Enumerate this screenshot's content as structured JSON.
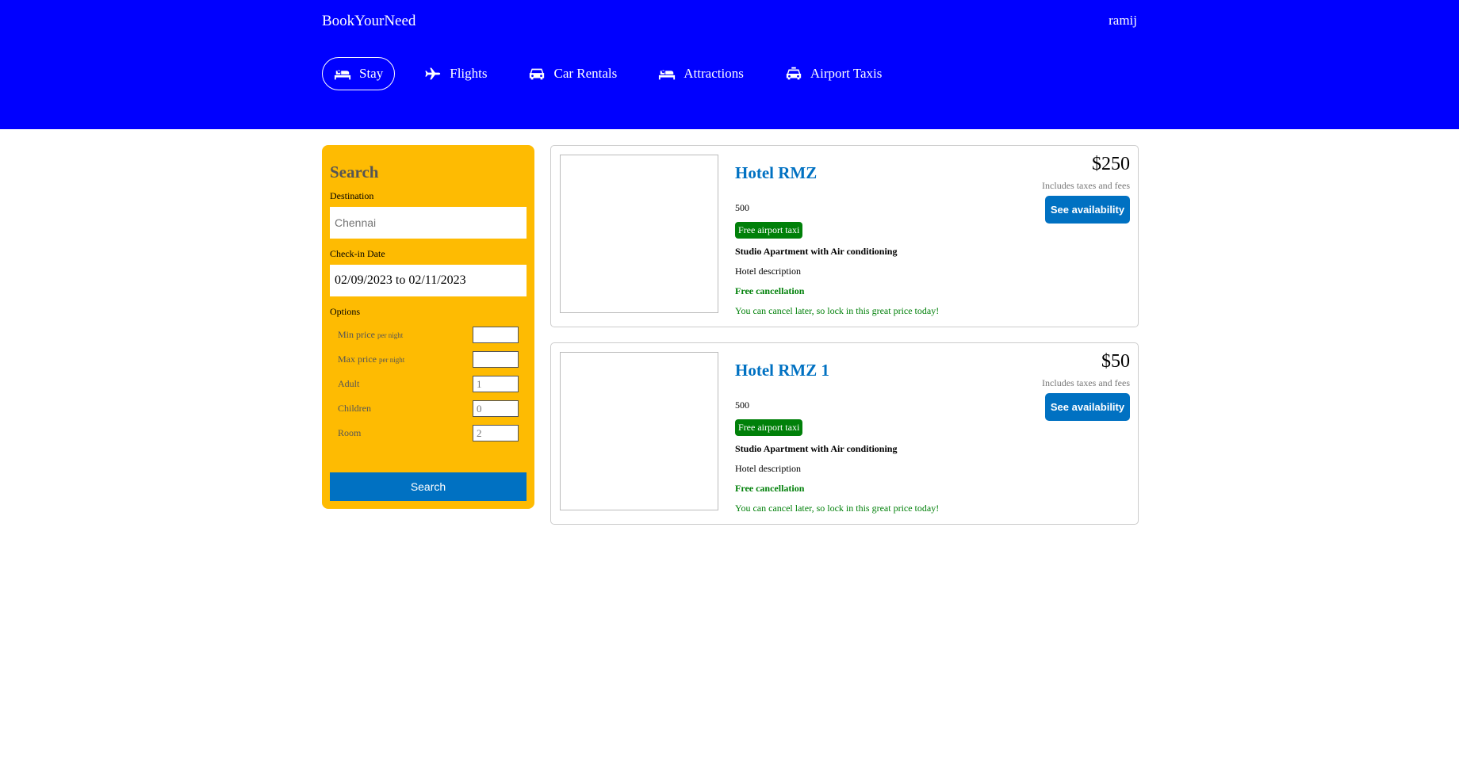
{
  "header": {
    "brand": "BookYourNeed",
    "user": "ramij",
    "nav": [
      {
        "label": "Stay",
        "icon": "bed-icon",
        "active": true
      },
      {
        "label": "Flights",
        "icon": "plane-icon",
        "active": false
      },
      {
        "label": "Car Rentals",
        "icon": "car-icon",
        "active": false
      },
      {
        "label": "Attractions",
        "icon": "bed-icon",
        "active": false
      },
      {
        "label": "Airport Taxis",
        "icon": "taxi-icon",
        "active": false
      }
    ]
  },
  "search": {
    "title": "Search",
    "destination_label": "Destination",
    "destination_placeholder": "Chennai",
    "checkin_label": "Check-in Date",
    "checkin_value": "02/09/2023 to 02/11/2023",
    "options_label": "Options",
    "min_price_label": "Min price",
    "max_price_label": "Max price",
    "per_night": "per night",
    "adult_label": "Adult",
    "adult_placeholder": "1",
    "children_label": "Children",
    "children_placeholder": "0",
    "room_label": "Room",
    "room_placeholder": "2",
    "button": "Search"
  },
  "results": [
    {
      "name": "Hotel RMZ",
      "distance": "500",
      "taxi": "Free airport taxi",
      "subtitle": "Studio Apartment with Air conditioning",
      "description": "Hotel description",
      "cancel": "Free cancellation",
      "cancel_sub": "You can cancel later, so lock in this great price today!",
      "price": "$250",
      "tax_note": "Includes taxes and fees",
      "button": "See availability"
    },
    {
      "name": "Hotel RMZ 1",
      "distance": "500",
      "taxi": "Free airport taxi",
      "subtitle": "Studio Apartment with Air conditioning",
      "description": "Hotel description",
      "cancel": "Free cancellation",
      "cancel_sub": "You can cancel later, so lock in this great price today!",
      "price": "$50",
      "tax_note": "Includes taxes and fees",
      "button": "See availability"
    }
  ],
  "colors": {
    "header": "#0000ff",
    "sidebar": "#febb02",
    "accent": "#0071c2",
    "green": "#008009"
  }
}
